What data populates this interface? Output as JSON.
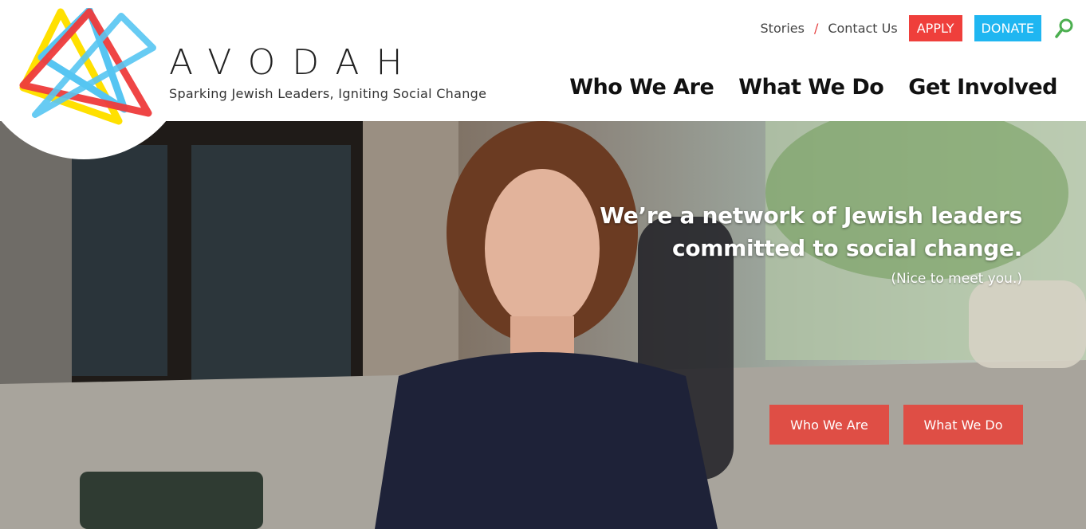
{
  "brand": {
    "name": "AVODAH",
    "tagline": "Sparking Jewish Leaders, Igniting Social Change",
    "logo_icon": "star-of-david-logo-icon",
    "colors": {
      "yellow": "#ffe000",
      "blue": "#56c5f2",
      "red": "#ee3b3b"
    }
  },
  "utility_nav": {
    "stories": "Stories",
    "separator": "/",
    "contact": "Contact Us",
    "apply": "APPLY",
    "donate": "DONATE",
    "search_icon": "search-icon",
    "colors": {
      "apply": "#ef3f3b",
      "donate": "#1fb6f1",
      "search": "#4caf50"
    }
  },
  "main_nav": {
    "items": [
      {
        "label": "Who We Are"
      },
      {
        "label": "What We Do"
      },
      {
        "label": "Get Involved"
      }
    ]
  },
  "hero": {
    "headline_line1": "We’re a network of Jewish leaders",
    "headline_line2": "committed to social change.",
    "subtext": "(Nice to meet you.)",
    "buttons": [
      {
        "label": "Who We Are"
      },
      {
        "label": "What We Do"
      }
    ],
    "button_color": "#e4463e"
  }
}
